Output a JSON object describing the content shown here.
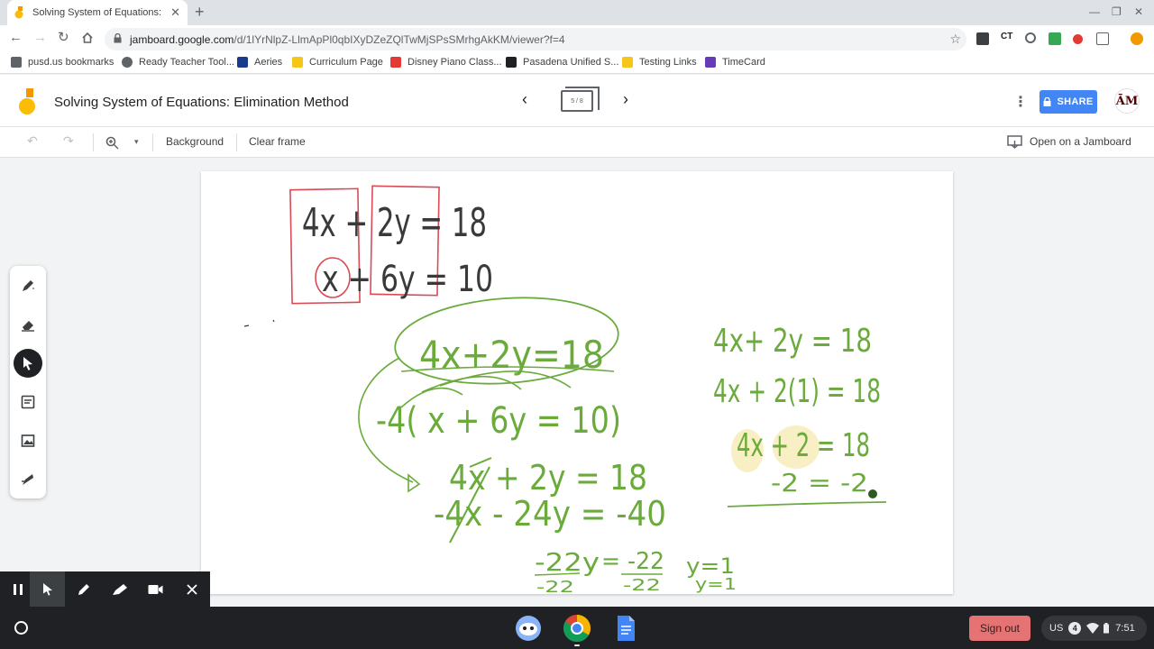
{
  "browser": {
    "tab_title": "Solving System of Equations: Eli",
    "url_host": "jamboard.google.com",
    "url_path": "/d/1lYrNlpZ-LlmApPl0qbIXyDZeZQlTwMjSPsSMrhgAkKM/viewer?f=4"
  },
  "bookmarks": [
    {
      "label": "pusd.us bookmarks",
      "color": "#5f6368"
    },
    {
      "label": "Ready Teacher Tool...",
      "color": "#5f6368"
    },
    {
      "label": "Aeries",
      "color": "#1a3a8c"
    },
    {
      "label": "Curriculum Page",
      "color": "#f5c518"
    },
    {
      "label": "Disney Piano Class...",
      "color": "#e53935"
    },
    {
      "label": "Pasadena Unified S...",
      "color": "#202124"
    },
    {
      "label": "Testing Links",
      "color": "#f5c518"
    },
    {
      "label": "TimeCard",
      "color": "#673ab7"
    }
  ],
  "jamboard": {
    "title": "Solving System of Equations: Elimination Method",
    "frame_indicator": "5 / 8",
    "share_label": "SHARE",
    "avatar_text": "ĀM",
    "toolbar": {
      "background": "Background",
      "clear_frame": "Clear frame",
      "open_on_jamboard": "Open on a Jamboard"
    }
  },
  "whiteboard": {
    "eq1": "4x + 2y = 18",
    "eq2": "x + 6y = 10",
    "eq_top_circled": "4x+2y=18",
    "eq_mult": "-4( x + 6y = 10)",
    "step1": "4x + 2y = 18",
    "step2": "-4x - 24y = -40",
    "step3_left": "-22y",
    "step3_right": "= -22",
    "step3_div_left": "-22",
    "step3_div_right": "-22",
    "result_y": "y=1",
    "sub1": "4x+ 2y = 18",
    "sub2": "4x + 2(1) = 18",
    "sub3": "4x + 2 = 18",
    "sub4": "-2 = -2"
  },
  "shelf": {
    "sign_out": "Sign out",
    "locale": "US",
    "notif_count": "4",
    "time": "7:51"
  },
  "colors": {
    "ink_red": "#d94b55",
    "ink_green": "#6aab3c",
    "share_blue": "#4285f4",
    "highlight_yellow": "#f9efc4"
  }
}
